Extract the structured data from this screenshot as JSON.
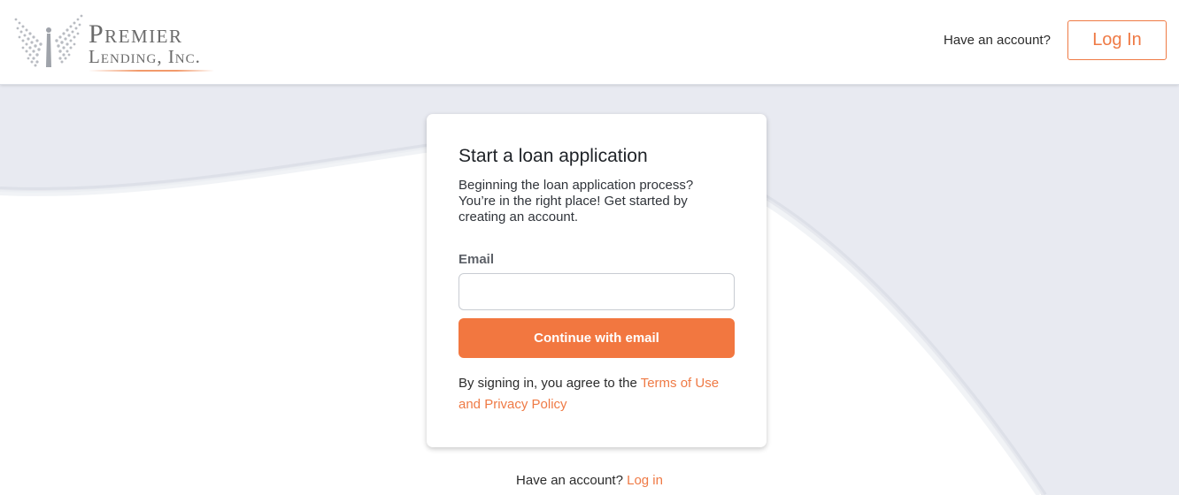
{
  "brand": {
    "name_line1": "Premier",
    "name_line2": "Lending, Inc.",
    "accent_color": "#f27740"
  },
  "header": {
    "account_prompt": "Have an account?",
    "login_label": "Log In"
  },
  "card": {
    "title": "Start a loan application",
    "description": "Beginning the loan application process? You’re in the right place! Get started by creating an account.",
    "email_label": "Email",
    "email_value": "",
    "email_placeholder": "",
    "continue_label": "Continue with email",
    "terms_prefix": "By signing in, you agree to the ",
    "terms_link": "Terms of Use and Privacy Policy"
  },
  "footer": {
    "account_prompt": "Have an account? ",
    "login_link": "Log in"
  },
  "colors": {
    "background_band": "#e8eaf1",
    "link": "#ef7a45",
    "button": "#f27740"
  }
}
